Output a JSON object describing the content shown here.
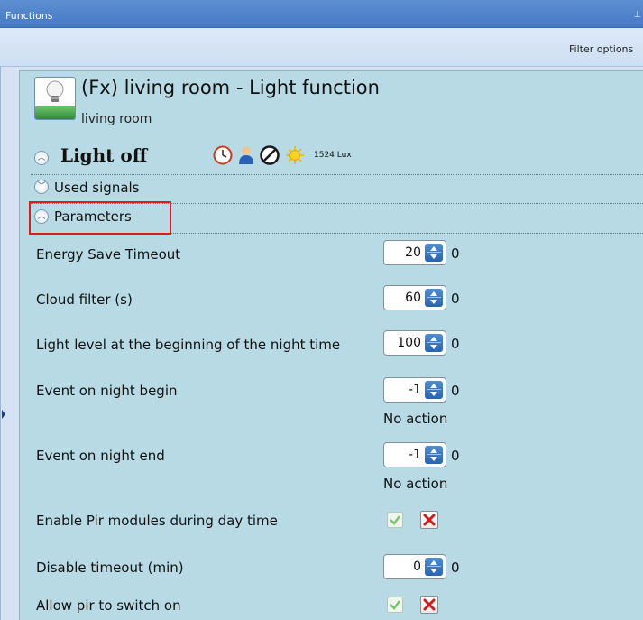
{
  "window": {
    "title": "Functions"
  },
  "toolbar": {
    "filter_label": "Filter options"
  },
  "function": {
    "title": "(Fx) living room - Light function",
    "room": "living room",
    "status": "Light off",
    "lux": "1524 Lux",
    "status_icons": [
      "clock-icon",
      "person-icon",
      "disabled-icon",
      "sun-icon"
    ]
  },
  "sections": {
    "used_signals": "Used signals",
    "parameters": "Parameters"
  },
  "parameters": [
    {
      "label": "Energy Save Timeout",
      "value": "20",
      "extra": "0"
    },
    {
      "label": "Cloud filter (s)",
      "value": "60",
      "extra": "0"
    },
    {
      "label": "Light level at the beginning of the night time",
      "value": "100",
      "extra": "0"
    },
    {
      "label": "Event on night begin",
      "value": "-1",
      "extra": "0",
      "note": "No action"
    },
    {
      "label": "Event on night end",
      "value": "-1",
      "extra": "0",
      "note": "No action"
    },
    {
      "label": "Enable Pir modules during day time",
      "toggle": true
    },
    {
      "label": "Disable timeout (min)",
      "value": "0",
      "extra": "0"
    },
    {
      "label": "Allow pir to switch on",
      "toggle": true
    }
  ],
  "colors": {
    "titlebar": "#4f83c9",
    "panel": "#b7dae4",
    "highlight": "#e11b1b",
    "spin_arrows": "#3a78c4"
  }
}
